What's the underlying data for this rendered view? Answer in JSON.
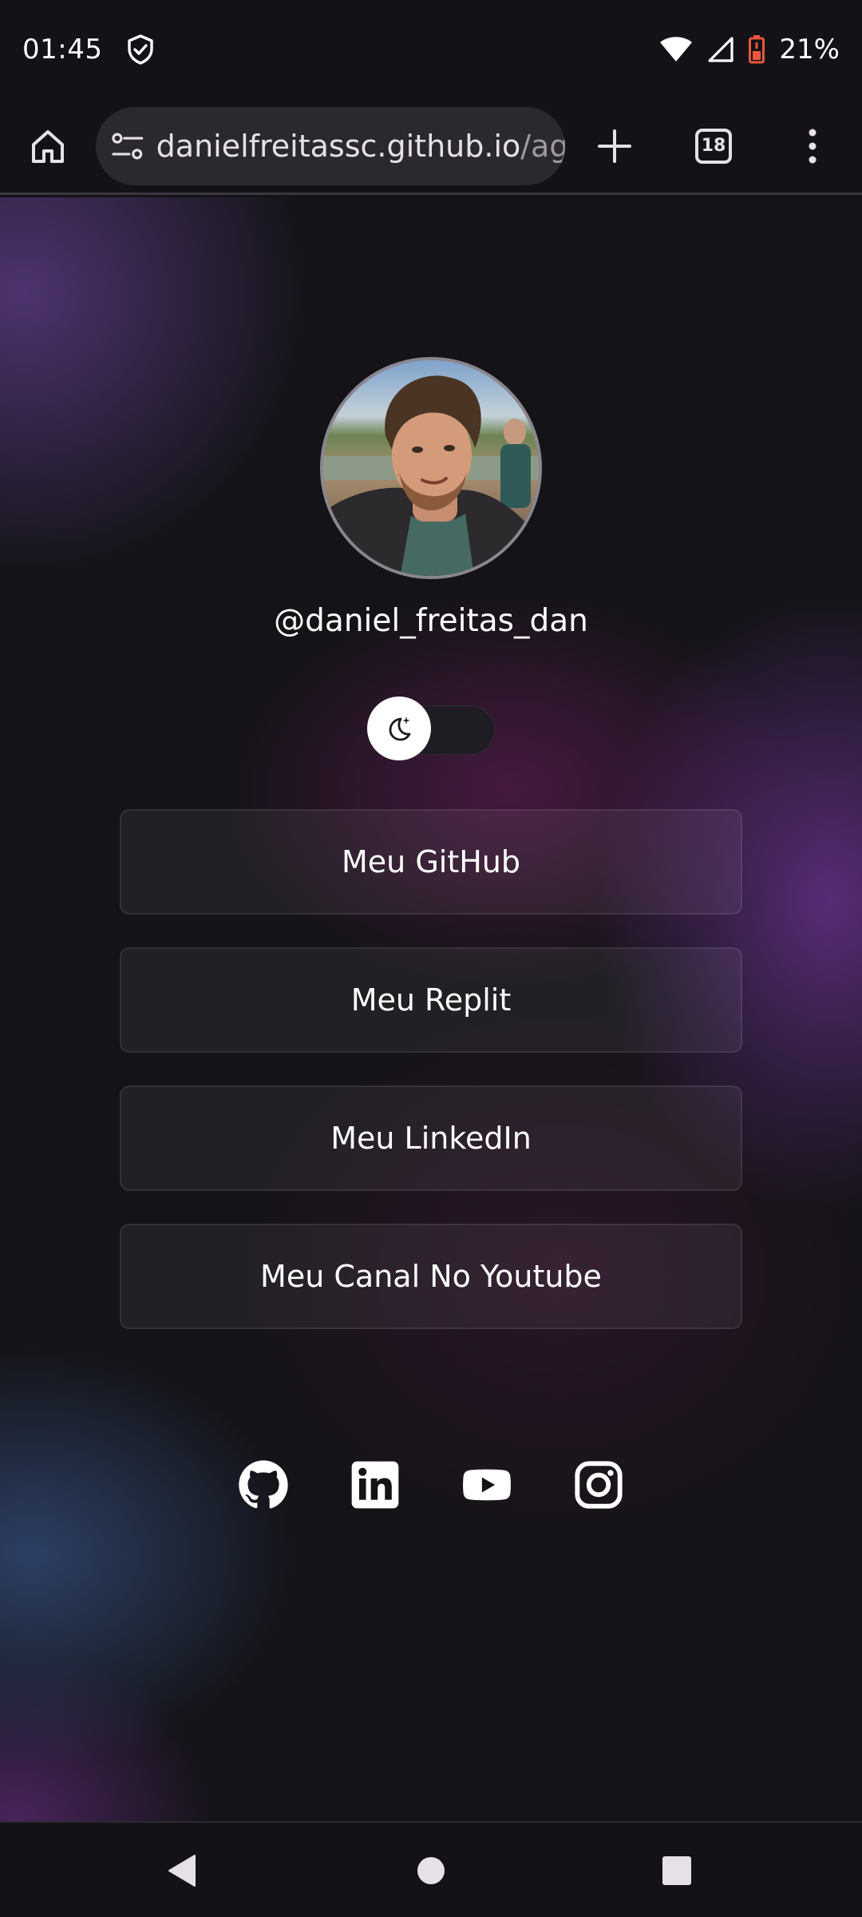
{
  "status_bar": {
    "time": "01:45",
    "battery": "21%"
  },
  "toolbar": {
    "url_host": "danielfreitassc.github.io",
    "url_path": "/ag",
    "tab_count": "18"
  },
  "profile": {
    "username": "@daniel_freitas_dan"
  },
  "links": [
    {
      "label": "Meu GitHub"
    },
    {
      "label": "Meu Replit"
    },
    {
      "label": "Meu LinkedIn"
    },
    {
      "label": "Meu Canal No Youtube"
    }
  ],
  "icons": {
    "social": [
      "github-icon",
      "linkedin-icon",
      "youtube-icon",
      "instagram-icon"
    ]
  },
  "colors": {
    "background": "#141317",
    "button_fill": "rgba(255,255,255,0.06)",
    "battery_low": "#e8573b",
    "text": "#ffffff"
  }
}
